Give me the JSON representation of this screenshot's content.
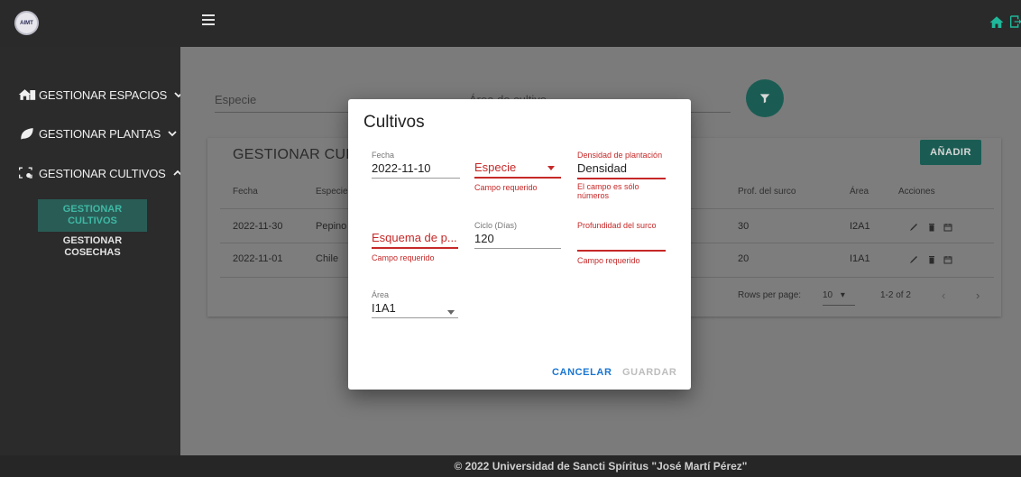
{
  "app": {
    "logo_text": "AIMT"
  },
  "sidebar": {
    "items": [
      {
        "label": "GESTIONAR ESPACIOS"
      },
      {
        "label": "GESTIONAR PLANTAS"
      },
      {
        "label": "GESTIONAR CULTIVOS"
      }
    ],
    "sub_items": [
      {
        "label_line1": "GESTIONAR",
        "label_line2": "CULTIVOS"
      },
      {
        "label_line1": "GESTIONAR",
        "label_line2": "COSECHAS"
      }
    ]
  },
  "filters": {
    "especie_label": "Especie",
    "area_label": "Área de cultivo"
  },
  "card": {
    "title": "GESTIONAR CULTIVOS",
    "add_label": "AÑADIR",
    "headers": {
      "fecha": "Fecha",
      "especie": "Especie",
      "prof": "Prof. del surco",
      "area": "Área",
      "acciones": "Acciones"
    },
    "rows": [
      {
        "fecha": "2022-11-30",
        "especie": "Pepino",
        "prof": "30",
        "area": "I2A1"
      },
      {
        "fecha": "2022-11-01",
        "especie": "Chile",
        "prof": "20",
        "area": "I1A1"
      }
    ],
    "pagination": {
      "rows_label": "Rows per page:",
      "rows_value": "10",
      "range": "1-2 of 2"
    }
  },
  "footer": {
    "text": "© 2022 Universidad de Sancti Spíritus \"José Martí Pérez\""
  },
  "dialog": {
    "title": "Cultivos",
    "fecha": {
      "label": "Fecha",
      "value": "2022-11-10"
    },
    "especie": {
      "placeholder": "Especie",
      "hint": "Campo requerido"
    },
    "densidad": {
      "label": "Densidad de plantación",
      "value": "Densidad",
      "hint": "El campo es sólo números"
    },
    "esquema": {
      "placeholder": "Esquema de p...",
      "hint": "Campo requerido"
    },
    "ciclo": {
      "label": "Ciclo (Días)",
      "value": "120"
    },
    "profundidad": {
      "label": "Profundidad del surco",
      "value": "",
      "hint": "Campo requerido"
    },
    "area": {
      "label": "Área",
      "value": "I1A1"
    },
    "cancel_label": "CANCELAR",
    "save_label": "GUARDAR"
  },
  "colors": {
    "accent": "#1a5c53",
    "error": "#c62828",
    "primary_text_button": "#1976d2"
  }
}
